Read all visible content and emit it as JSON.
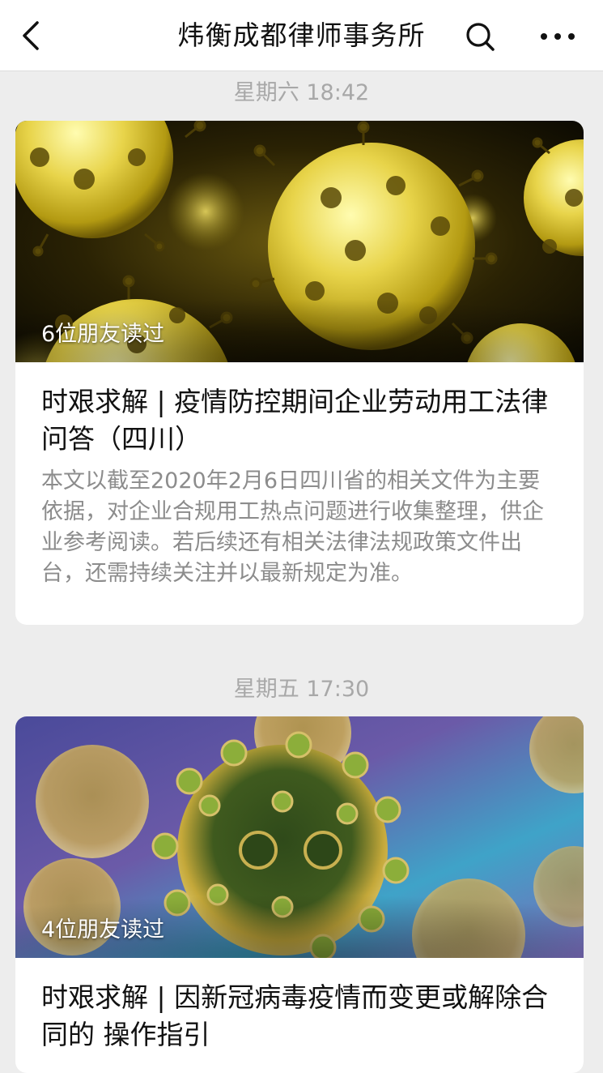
{
  "header": {
    "title": "炜衡成都律师事务所",
    "back_icon": "chevron-left-icon",
    "search_icon": "search-icon",
    "more_icon": "more-dots-icon"
  },
  "feed": [
    {
      "time": "星期六 18:42",
      "friends_read": "6位朋友读过",
      "title": "时艰求解 | 疫情防控期间企业劳动用工法律问答（四川）",
      "summary": "本文以截至2020年2月6日四川省的相关文件为主要依据，对企业合规用工热点问题进行收集整理，供企业参考阅读。若后续还有相关法律法规政策文件出台，还需持续关注并以最新规定为准。",
      "cover": "virus-yellow-dark-image"
    },
    {
      "time": "星期五 17:30",
      "friends_read": "4位朋友读过",
      "title": "时艰求解 | 因新冠病毒疫情而变更或解除合同的 操作指引",
      "cover": "virus-green-blue-image"
    }
  ]
}
